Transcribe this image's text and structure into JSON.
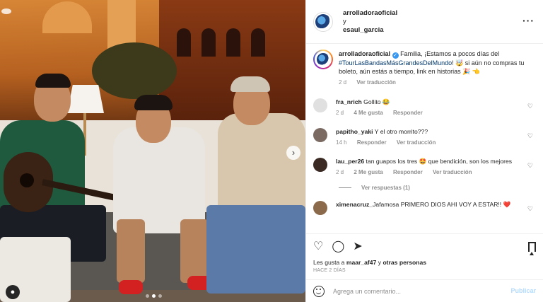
{
  "photo": {
    "icons": {
      "tag": "user-tag-icon",
      "next": "chevron-right-icon"
    },
    "carousel": {
      "count": 3,
      "active_index": 1
    }
  },
  "header": {
    "user1": "arrolladoraoficial",
    "conjunction": "y",
    "user2": "esaul_garcia",
    "more_icon": "ellipsis-icon"
  },
  "caption": {
    "username": "arrolladoraoficial",
    "text_before": "Familia, ¡Estamos a pocos días del ",
    "hashtag": "#TourLasBandasMásGrandesDelMundo",
    "text_after": "! 🤯 si aún no compras tu boleto, aún estás a tiempo, link en historias 🎉 👈",
    "time": "2 d",
    "translate": "Ver traducción"
  },
  "comments": [
    {
      "username": "fra_nrich",
      "text": "Gollito 😂",
      "time": "2 d",
      "likes": "4 Me gusta",
      "reply": "Responder",
      "translate": "",
      "avatar_color": "#e0e0e0"
    },
    {
      "username": "papitho_yaki",
      "text": "Y el otro morrito???",
      "time": "14 h",
      "likes": "",
      "reply": "Responder",
      "translate": "Ver traducción",
      "avatar_color": "#7a6a62"
    },
    {
      "username": "lau_per26",
      "text": "tan guapos los tres 🤩 que bendición, son los mejores",
      "time": "2 d",
      "likes": "2 Me gusta",
      "reply": "Responder",
      "translate": "Ver traducción",
      "avatar_color": "#3b2a24"
    },
    {
      "username": "ximenacruz_",
      "text": "Jafamosa PRIMERO DIOS AHI VOY A ESTAR!! ❤️",
      "time": "",
      "likes": "",
      "reply": "",
      "translate": "",
      "avatar_color": "#8a6a4a"
    }
  ],
  "replies_link": "Ver respuestas (1)",
  "actions": {
    "like_icon": "heart-icon",
    "comment_icon": "comment-icon",
    "share_icon": "send-icon",
    "save_icon": "bookmark-icon"
  },
  "likes": {
    "prefix": "Les gusta a ",
    "user": "maar_af47",
    "middle": " y ",
    "others": "otras personas"
  },
  "posted_ago": "Hace 2 días",
  "add_comment": {
    "placeholder": "Agrega un comentario...",
    "post_label": "Publicar",
    "emoji_icon": "emoji-icon"
  }
}
